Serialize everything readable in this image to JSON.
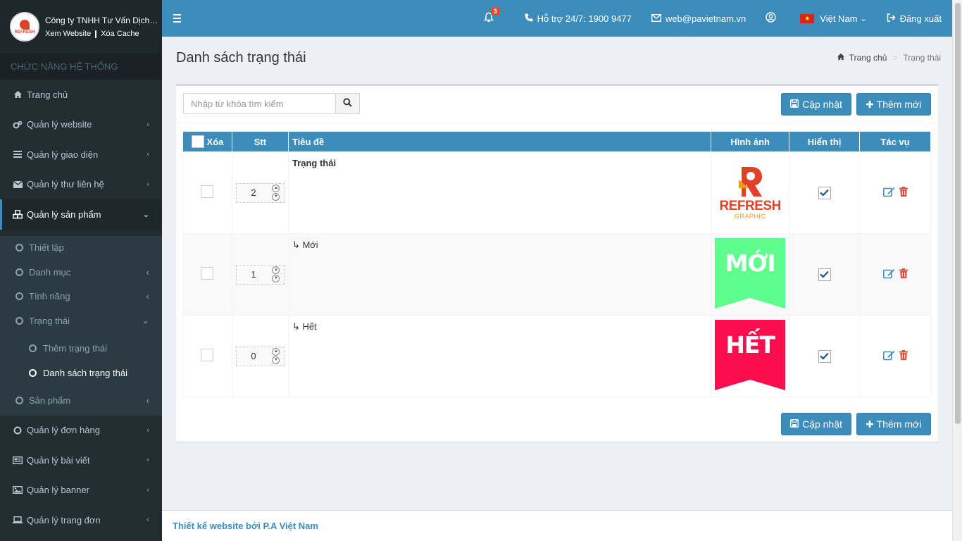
{
  "sidebar": {
    "brand_name": "Công ty TNHH Tư Vấn Dịch Vụ P.A Việt Nam",
    "logo_text": "REFRESH",
    "view_website": "Xem Website",
    "clear_cache": "Xóa Cache",
    "section_header": "CHỨC NĂNG HỆ THỐNG",
    "menu": [
      {
        "label": "Trang chủ",
        "icon": "home-icon"
      },
      {
        "label": "Quản lý website",
        "icon": "cogs-icon"
      },
      {
        "label": "Quản lý giao diện",
        "icon": "bars-icon"
      },
      {
        "label": "Quản lý thư liên hệ",
        "icon": "envelope-icon"
      },
      {
        "label": "Quản lý sản phẩm",
        "icon": "cubes-icon"
      }
    ],
    "product_sub": [
      {
        "label": "Thiết lập"
      },
      {
        "label": "Danh mục"
      },
      {
        "label": "Tính năng"
      },
      {
        "label": "Trạng thái"
      }
    ],
    "status_sub": [
      {
        "label": "Thêm trạng thái"
      },
      {
        "label": "Danh sách trạng thái"
      }
    ],
    "product_last": "Sản phẩm",
    "menu_bottom": [
      {
        "label": "Quản lý đơn hàng",
        "icon": "circle-icon"
      },
      {
        "label": "Quản lý bài viết",
        "icon": "newspaper-icon"
      },
      {
        "label": "Quản lý banner",
        "icon": "image-icon"
      },
      {
        "label": "Quản lý trang đơn",
        "icon": "laptop-icon"
      }
    ]
  },
  "header": {
    "notification_count": "3",
    "support": "Hỗ trợ 24/7: 1900 9477",
    "email": "web@pavietnam.vn",
    "language": "Việt Nam",
    "logout": "Đăng xuất"
  },
  "page": {
    "title": "Danh sách trạng thái",
    "breadcrumb_home": "Trang chủ",
    "breadcrumb_current": "Trạng thái"
  },
  "toolbar": {
    "search_placeholder": "Nhập từ khóa tìm kiếm",
    "update_label": "Cập nhật",
    "add_label": "Thêm mới"
  },
  "table": {
    "headers": {
      "delete": "Xóa",
      "order": "Stt",
      "title": "Tiêu đề",
      "image": "Hình ảnh",
      "display": "Hiển thị",
      "actions": "Tác vụ"
    },
    "rows": [
      {
        "order": "2",
        "title": "Trạng thái",
        "image_text": "REFRESH",
        "image_sub": "GRAPHIC",
        "bold": true
      },
      {
        "order": "1",
        "title": "↳ Mới",
        "image_text": "MỚI",
        "image_color": "#5dfd8e"
      },
      {
        "order": "0",
        "title": "↳ Hết",
        "image_text": "HẾT",
        "image_color": "#fb0e4d"
      }
    ]
  },
  "footer": {
    "text": "Thiết kế website bởi P.A Việt Nam"
  },
  "colors": {
    "primary": "#3c8dbc",
    "sidebar_bg": "#222d32",
    "delete_red": "#dd4b39"
  }
}
